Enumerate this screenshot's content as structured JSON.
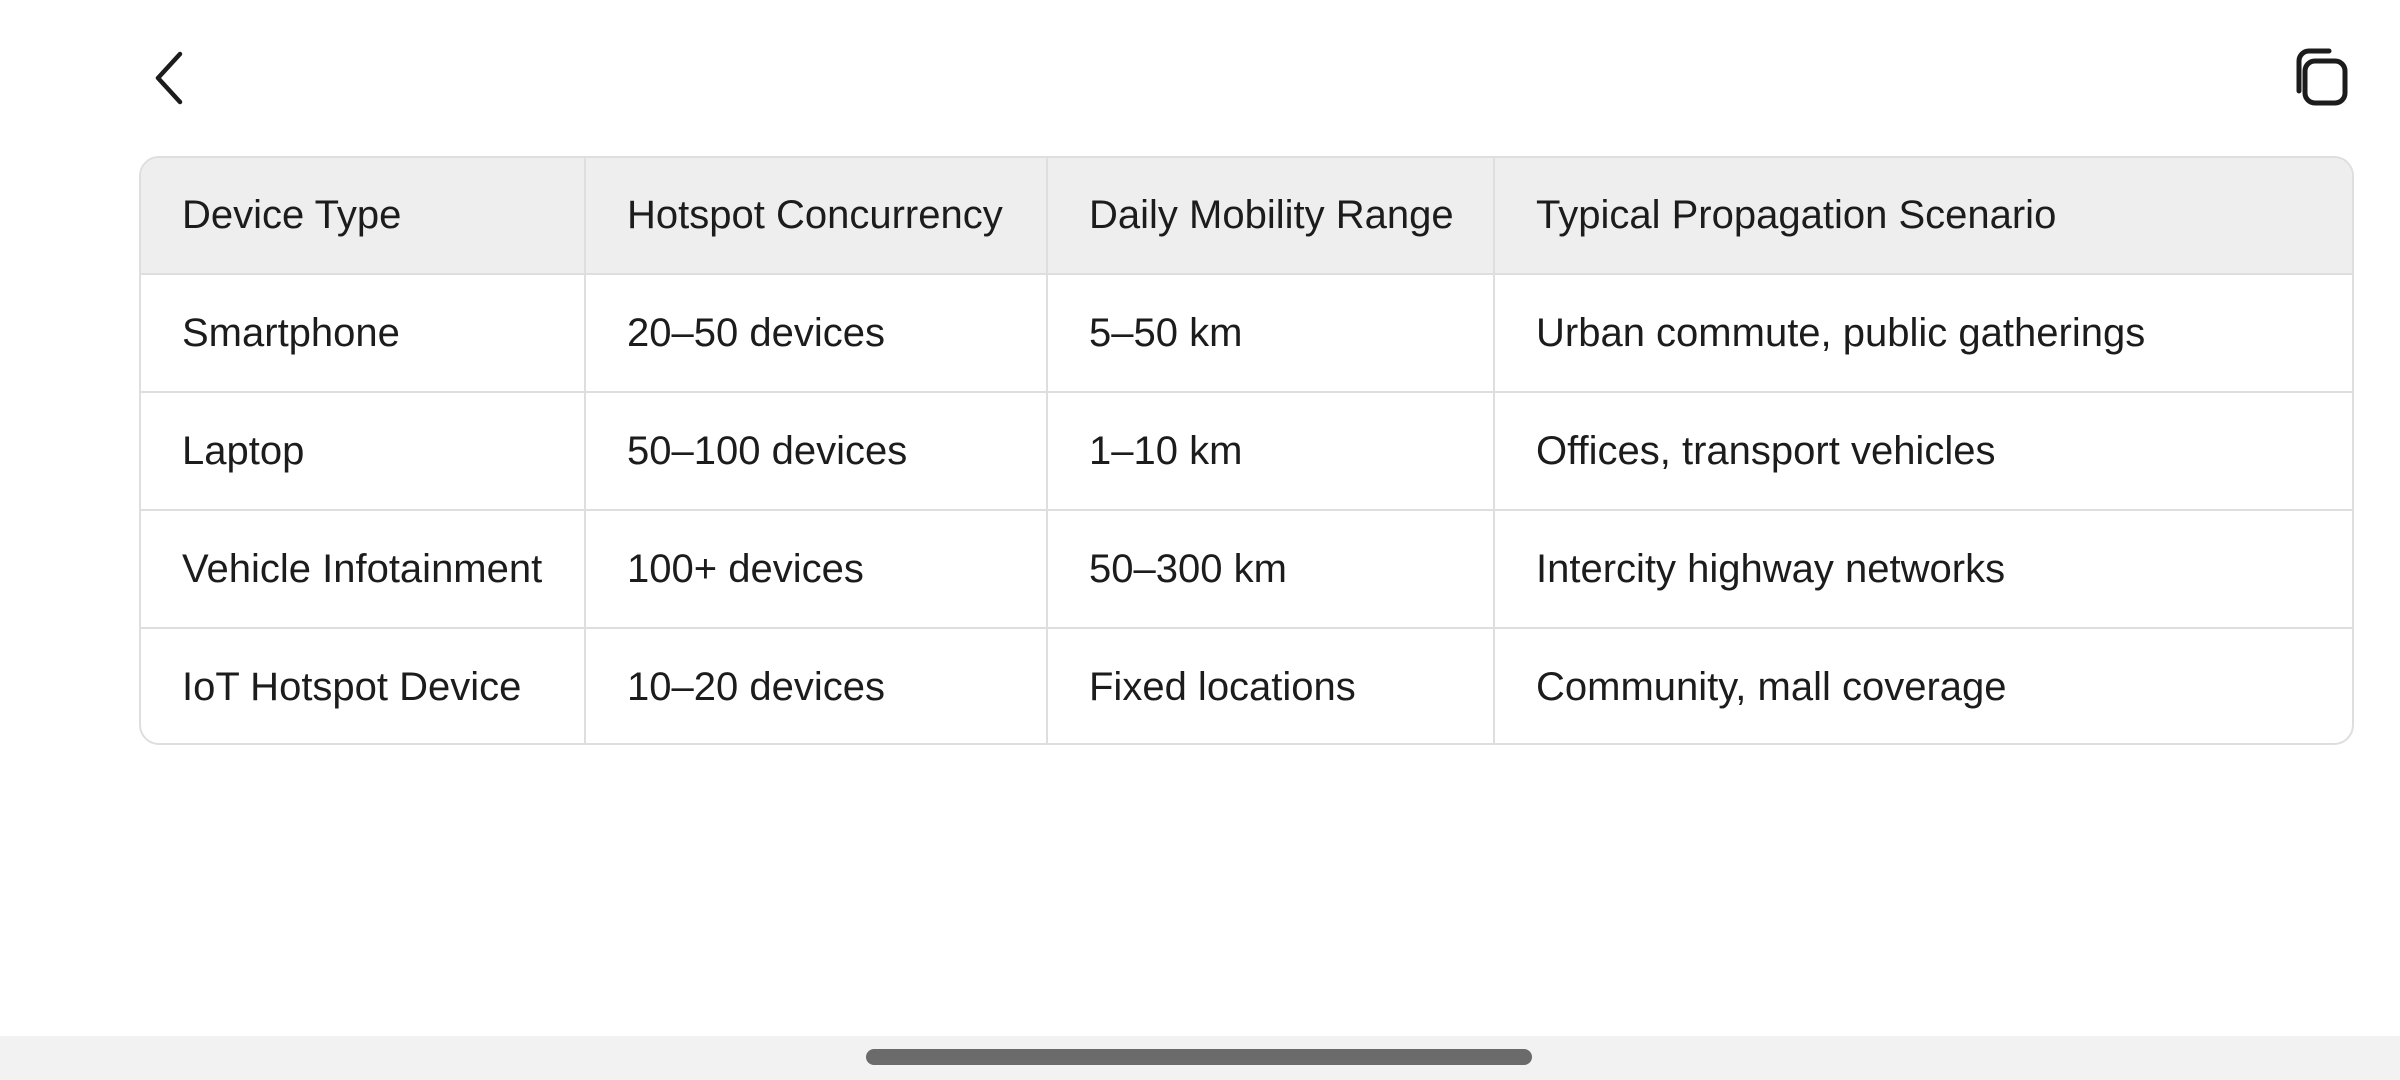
{
  "toolbar": {
    "back_icon": "chevron-left-icon",
    "copy_icon": "copy-icon"
  },
  "table": {
    "headers": [
      "Device Type",
      "Hotspot Concurrency",
      "Daily Mobility Range",
      "Typical Propagation Scenario"
    ],
    "rows": [
      [
        "Smartphone",
        "20–50 devices",
        "5–50 km",
        "Urban commute, public gatherings"
      ],
      [
        "Laptop",
        "50–100 devices",
        "1–10 km",
        "Offices, transport vehicles"
      ],
      [
        "Vehicle Infotainment",
        "100+ devices",
        "50–300 km",
        "Intercity highway networks"
      ],
      [
        "IoT Hotspot Device",
        "10–20 devices",
        "Fixed locations",
        "Community, mall coverage"
      ]
    ]
  },
  "colors": {
    "header_bg": "#eeeeee",
    "border": "#dedede",
    "text": "#1c1c1c",
    "nav_bar_bg": "#f2f2f2",
    "home_indicator": "#6b6b6b"
  }
}
